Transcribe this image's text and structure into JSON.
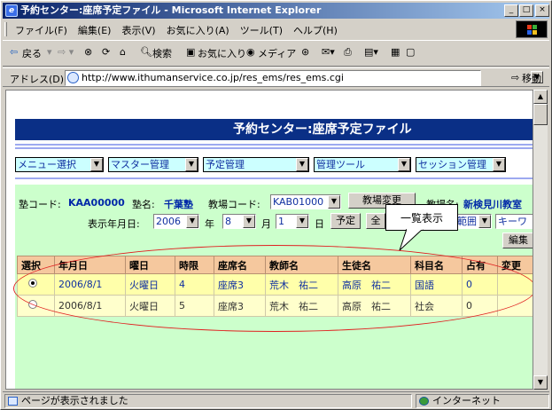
{
  "window": {
    "title": "予約センター:座席予定ファイル - Microsoft Internet Explorer"
  },
  "menubar": [
    "ファイル(F)",
    "編集(E)",
    "表示(V)",
    "お気に入り(A)",
    "ツール(T)",
    "ヘルプ(H)"
  ],
  "toolbar": {
    "back": "戻る",
    "search": "検索",
    "favorites": "お気に入り",
    "media": "メディア"
  },
  "address": {
    "label": "アドレス(D)",
    "url": "http://www.ithumanservice.co.jp/res_ems/res_ems.cgi",
    "go": "移動"
  },
  "page": {
    "header": "予約センター:座席予定ファイル",
    "menus": [
      "メニュー選択",
      "マスター管理",
      "予定管理",
      "管理ツール",
      "セッション管理"
    ],
    "juku_code_label": "塾コード:",
    "juku_code": "KAA00000",
    "juku_name_label": "塾名:",
    "juku_name": "千葉塾",
    "kyojo_code_label": "教場コード:",
    "kyojo_code": "KAB01000",
    "kyojo_change": "教場変更",
    "kyojo_name_label": "教場名:",
    "kyojo_name": "新検見川教室",
    "date_label": "表示年月日:",
    "year": "2006",
    "year_unit": "年",
    "month": "8",
    "month_unit": "月",
    "day": "1",
    "day_unit": "日",
    "yotei_button": "予定",
    "zen_button": "全",
    "range_select": "範囲",
    "keyword_select": "キーワ",
    "edit_button": "編集",
    "callout": "一覧表示"
  },
  "table": {
    "columns": [
      "選択",
      "年月日",
      "曜日",
      "時限",
      "座席名",
      "教師名",
      "生徒名",
      "科目名",
      "占有",
      "変更"
    ],
    "rows": [
      {
        "selected": true,
        "date": "2006/8/1",
        "weekday": "火曜日",
        "period": "4",
        "seat": "座席3",
        "teacher": "荒木　祐二",
        "student": "高原　祐二",
        "subject": "国語",
        "occupied": "0",
        "change": ""
      },
      {
        "selected": false,
        "date": "2006/8/1",
        "weekday": "火曜日",
        "period": "5",
        "seat": "座席3",
        "teacher": "荒木　祐二",
        "student": "高原　祐二",
        "subject": "社会",
        "occupied": "0",
        "change": ""
      }
    ]
  },
  "status": {
    "message": "ページが表示されました",
    "zone": "インターネット"
  },
  "colors": {
    "header_bg": "#0a2f86",
    "panel_bg": "#ccffcc",
    "table_header": "#f5c89e",
    "row_selected": "#ffffaa",
    "highlight_oval": "#e02020"
  }
}
